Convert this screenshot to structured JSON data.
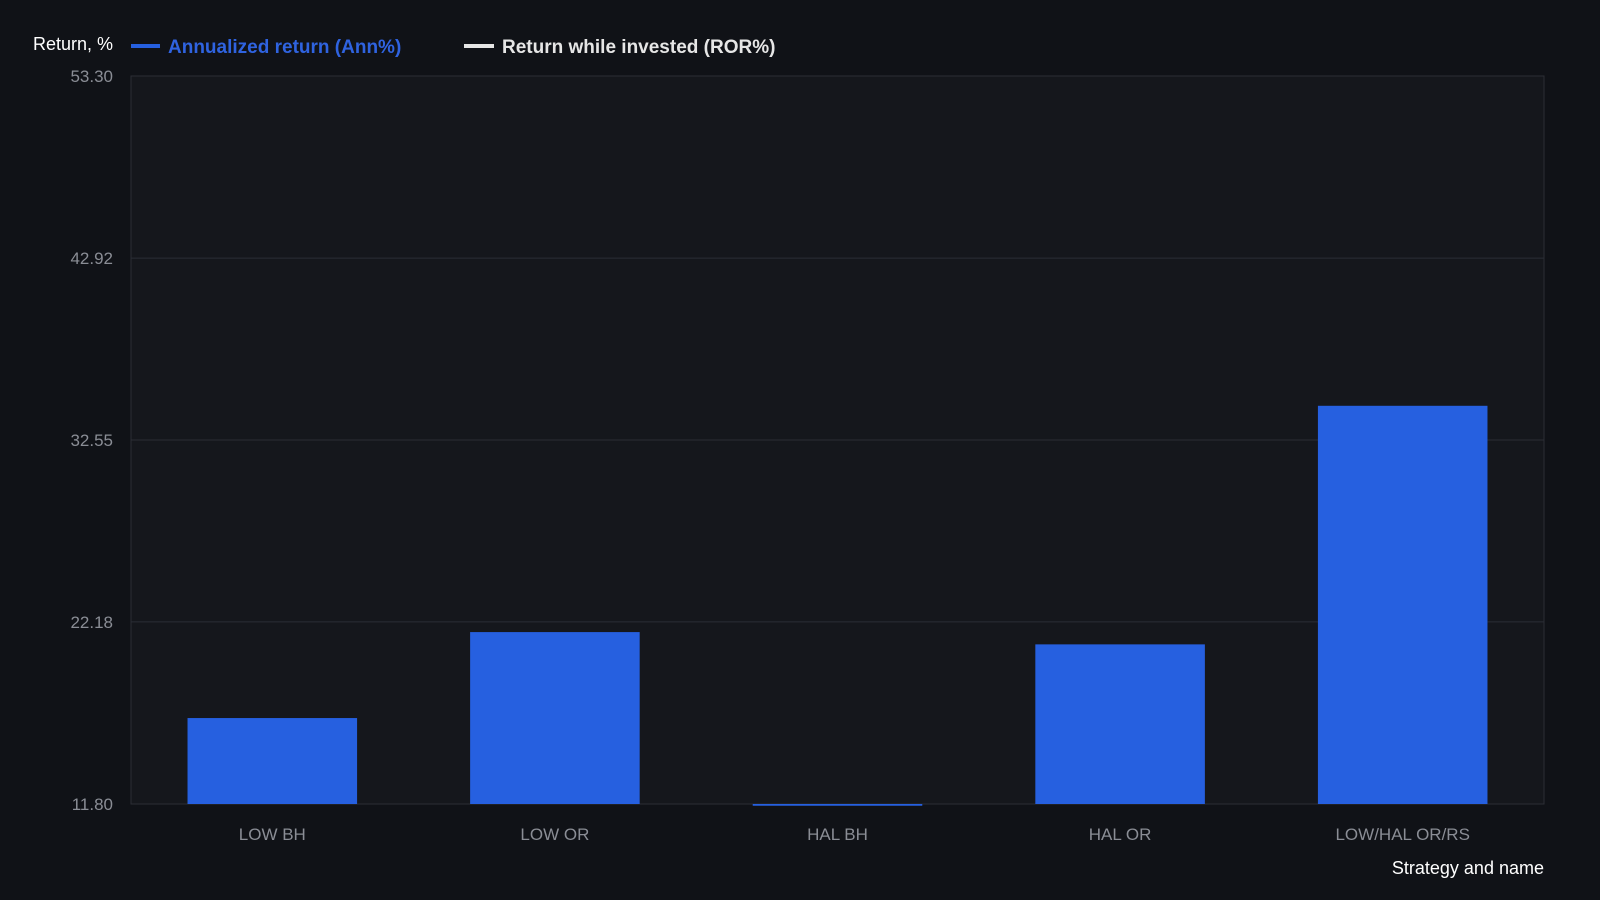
{
  "chart_data": {
    "type": "bar",
    "ylabel": "Return, %",
    "xlabel": "Strategy and name",
    "ylim": [
      11.8,
      53.3
    ],
    "yticks": [
      "53.30",
      "42.92",
      "32.55",
      "22.18",
      "11.80"
    ],
    "grid": true,
    "legend_placement": "top-left",
    "categories": [
      "LOW BH",
      "LOW OR",
      "HAL BH",
      "HAL OR",
      "LOW/HAL OR/RS"
    ],
    "series": [
      {
        "name": "Annualized return (Ann%)",
        "color": "#2660e0",
        "values": [
          16.7,
          21.6,
          11.7,
          20.9,
          34.5
        ]
      },
      {
        "name": "Return while invested (ROR%)",
        "color": "#e6e6e6",
        "values": []
      }
    ]
  }
}
